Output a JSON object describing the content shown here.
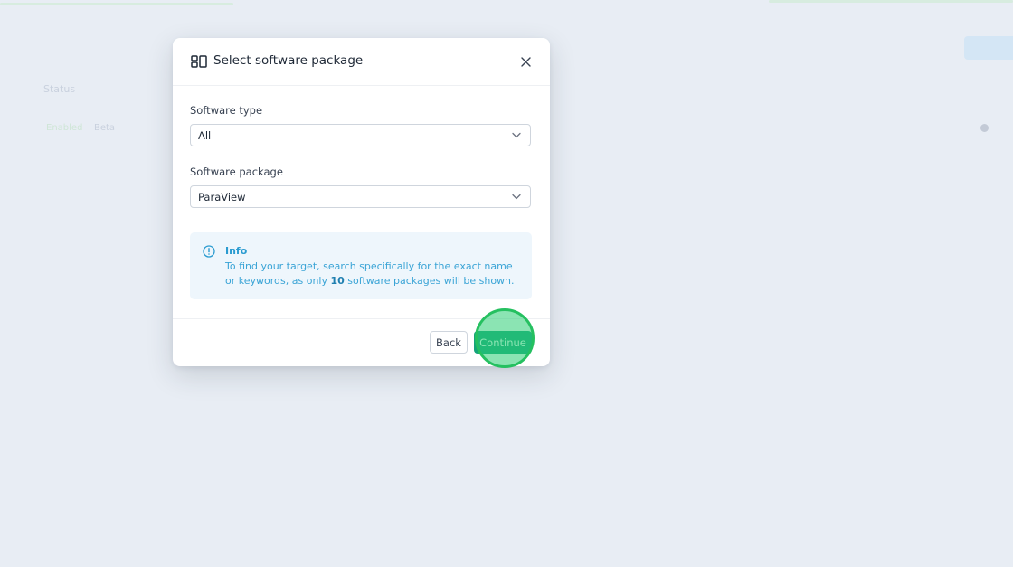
{
  "background": {
    "status_header": "Status",
    "status_value": "Enabled",
    "status_extra": "Beta"
  },
  "modal": {
    "title": "Select software package",
    "close_icon": "close-icon",
    "software_type": {
      "label": "Software type",
      "value": "All"
    },
    "software_package": {
      "label": "Software package",
      "value": "ParaView"
    },
    "info": {
      "title": "Info",
      "body_before": "To find your target, search specifically for the exact name or keywords, as only ",
      "body_count": "10",
      "body_after": " software packages will be shown."
    },
    "footer": {
      "back_label": "Back",
      "continue_label": "Continue"
    }
  },
  "colors": {
    "primary": "#15a37a",
    "info_text": "#3aa4d6",
    "info_bg": "#eef6fc",
    "highlight_ring": "#25c060"
  }
}
